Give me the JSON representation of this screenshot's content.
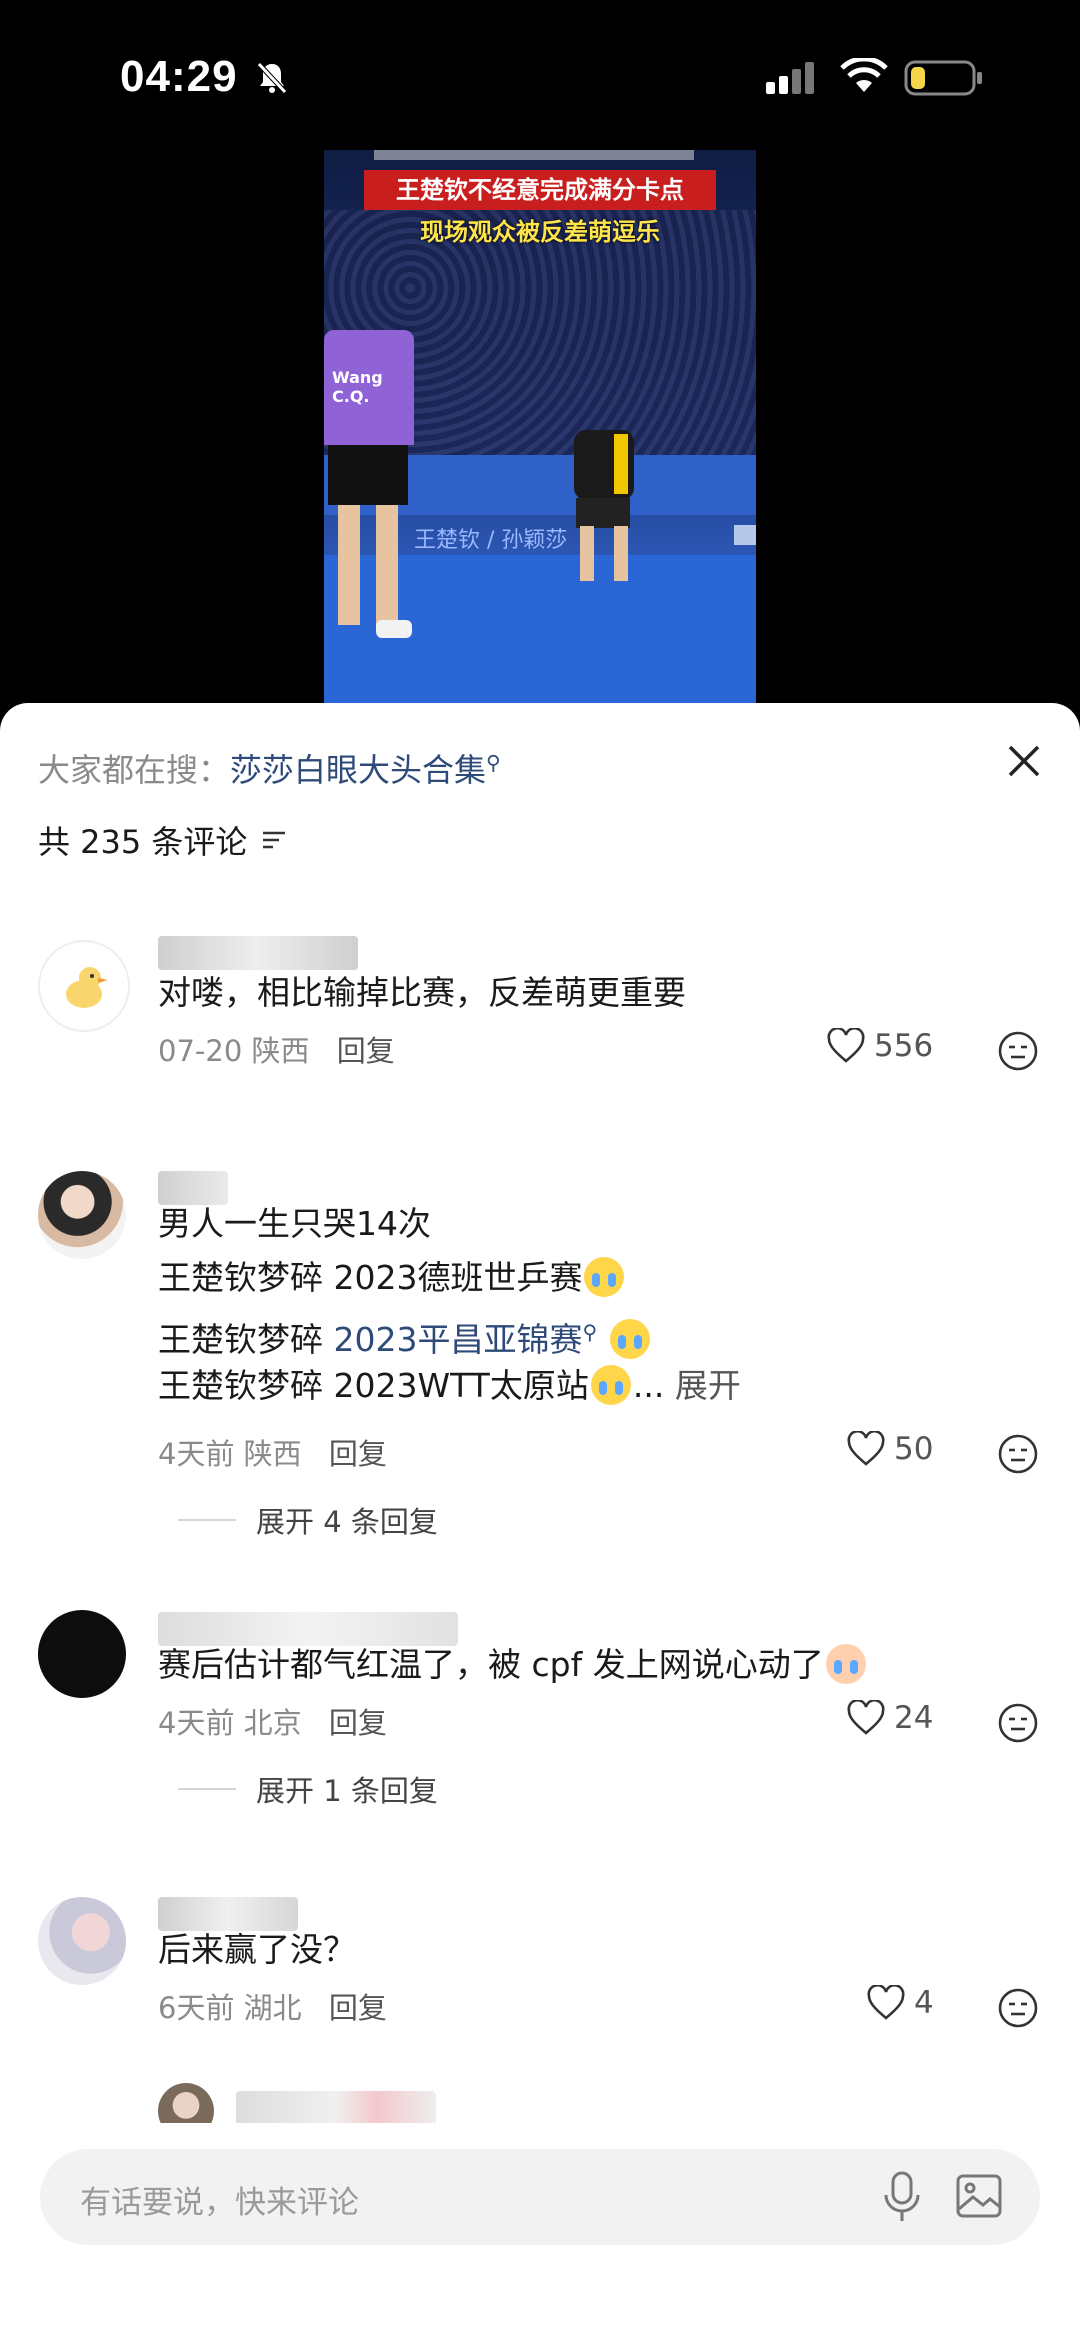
{
  "status_bar": {
    "time": "04:29"
  },
  "video": {
    "caption_line1": "王楚钦不经意完成满分卡点",
    "caption_line2": "现场观众被反差萌逗乐",
    "board_text": "王楚钦 / 孙颖莎",
    "player_tag": "Wang C.Q."
  },
  "search": {
    "prefix": "大家都在搜：",
    "keyword": "莎莎白眼大头合集"
  },
  "comments_header": {
    "count_text": "共 235 条评论"
  },
  "comments": [
    {
      "text": "对喽，相比输掉比赛，反差萌更重要",
      "date": "07-20",
      "location": "陕西",
      "reply_label": "回复",
      "likes": "556"
    },
    {
      "lines": [
        "男人一生只哭14次",
        "王楚钦梦碎 2023德班世乒赛",
        "王楚钦梦碎 ",
        "王楚钦梦碎 2023WTT太原站"
      ],
      "link_text": "2023平昌亚锦赛",
      "ellipsis": "...",
      "expand_label": "展开",
      "date": "4天前",
      "location": "陕西",
      "reply_label": "回复",
      "likes": "50",
      "more_replies": "展开 4 条回复"
    },
    {
      "text": "赛后估计都气红温了，被 cpf 发上网说心动了",
      "date": "4天前",
      "location": "北京",
      "reply_label": "回复",
      "likes": "24",
      "more_replies": "展开 1 条回复"
    },
    {
      "text": "后来赢了没？",
      "date": "6天前",
      "location": "湖北",
      "reply_label": "回复",
      "likes": "4"
    }
  ],
  "input": {
    "placeholder": "有话要说，快来评论"
  }
}
